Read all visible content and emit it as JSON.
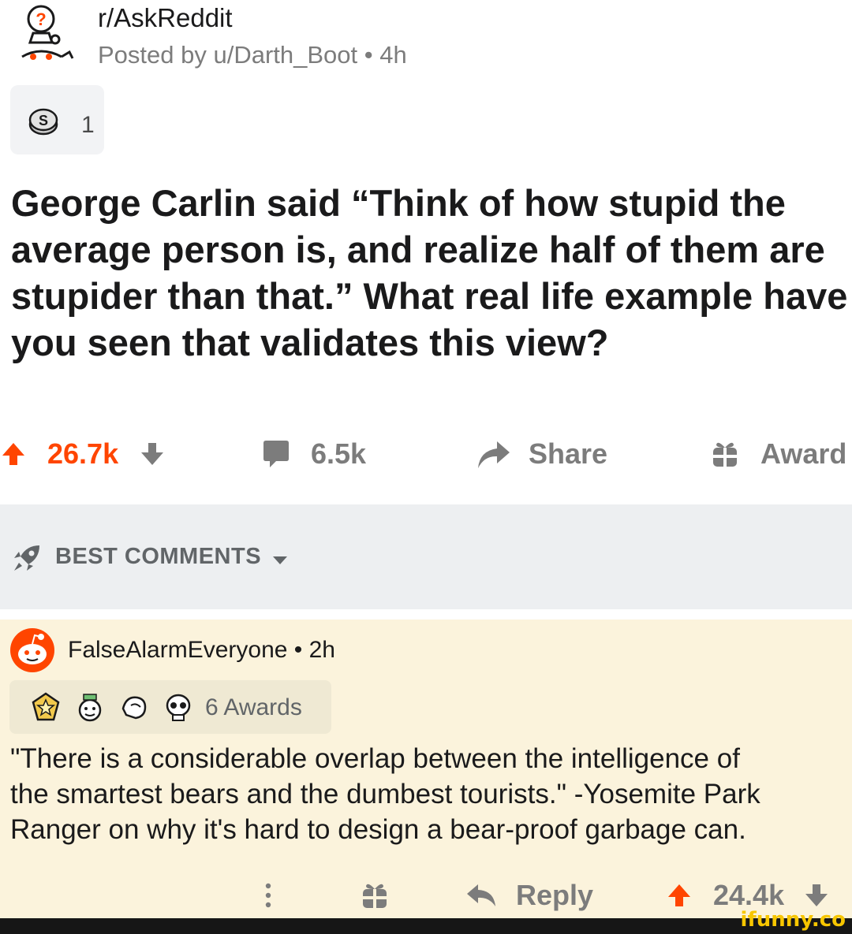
{
  "post": {
    "subreddit": "r/AskReddit",
    "posted_by": "Posted by u/Darth_Boot • 4h",
    "award_count": "1",
    "title": "George Carlin said “Think of how stupid the average person is, and realize half of them are stupider than that.” What real life example have you seen that validates this view?",
    "title_lines": [
      "George Carlin said “Think of how stupid the",
      "average person is, and realize half of them are",
      "stupider than that.” What real life example have",
      "you seen that validates this view?"
    ],
    "upvotes": "26.7k",
    "comments": "6.5k",
    "share_label": "Share",
    "award_label": "Award"
  },
  "sort": {
    "label": "BEST COMMENTS"
  },
  "comment": {
    "author_line": "FalseAlarmEveryone • 2h",
    "awards_label": "6 Awards",
    "body_lines": [
      "\"There is a considerable overlap between the intelligence of",
      "the smartest bears and the dumbest tourists.\" -Yosemite Park",
      "Ranger on why it's hard to design a bear-proof garbage can."
    ],
    "reply_label": "Reply",
    "upvotes": "24.4k"
  },
  "watermark": "ifunny.co",
  "colors": {
    "upvote": "#ff4500",
    "muted": "#7c7c7c",
    "sort_bg": "#edeff1",
    "comment_bg": "#fbf3dc"
  },
  "icons": [
    "askreddit-snoo-icon",
    "silver-award-icon",
    "upvote-icon",
    "downvote-icon",
    "comment-icon",
    "share-icon",
    "gift-icon",
    "rocket-icon",
    "caret-down-icon",
    "snoo-avatar-icon",
    "reply-icon",
    "more-dots-icon"
  ]
}
